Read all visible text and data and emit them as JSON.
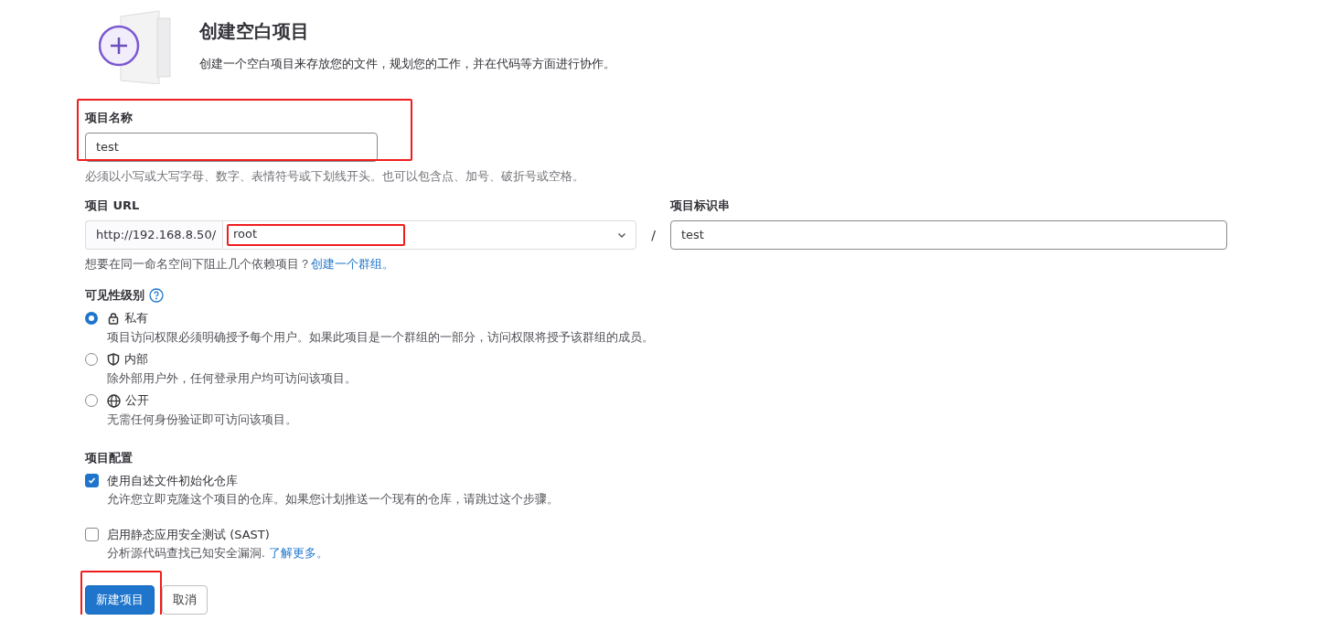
{
  "header": {
    "title": "创建空白项目",
    "description": "创建一个空白项目来存放您的文件，规划您的工作，并在代码等方面进行协作。"
  },
  "project_name": {
    "label": "项目名称",
    "value": "test",
    "highlighted": true,
    "hint": "必须以小写或大写字母、数字、表情符号或下划线开头。也可以包含点、加号、破折号或空格。"
  },
  "project_url": {
    "label": "项目 URL",
    "prefix": "http://192.168.8.50/",
    "namespace": "root",
    "namespace_highlighted": true,
    "separator": "/"
  },
  "project_slug": {
    "label": "项目标识串",
    "value": "test"
  },
  "url_hint": {
    "text": "想要在同一命名空间下阻止几个依赖项目？",
    "link": "创建一个群组。"
  },
  "visibility": {
    "label": "可见性级别",
    "options": [
      {
        "label": "私有",
        "description": "项目访问权限必须明确授予每个用户。如果此项目是一个群组的一部分，访问权限将授予该群组的成员。",
        "selected": true
      },
      {
        "label": "内部",
        "description": "除外部用户外，任何登录用户均可访问该项目。",
        "selected": false
      },
      {
        "label": "公开",
        "description": "无需任何身份验证即可访问该项目。",
        "selected": false
      }
    ]
  },
  "configuration": {
    "label": "项目配置",
    "options": [
      {
        "label": "使用自述文件初始化仓库",
        "description": "允许您立即克隆这个项目的仓库。如果您计划推送一个现有的仓库，请跳过这个步骤。",
        "checked": true
      },
      {
        "label": "启用静态应用安全测试 (SAST)",
        "description": "分析源代码查找已知安全漏洞. ",
        "link": "了解更多。",
        "checked": false
      }
    ]
  },
  "buttons": [
    {
      "label": "新建项目",
      "kind": "primary",
      "highlighted": true
    },
    {
      "label": "取消",
      "kind": "secondary",
      "highlighted": false
    }
  ]
}
